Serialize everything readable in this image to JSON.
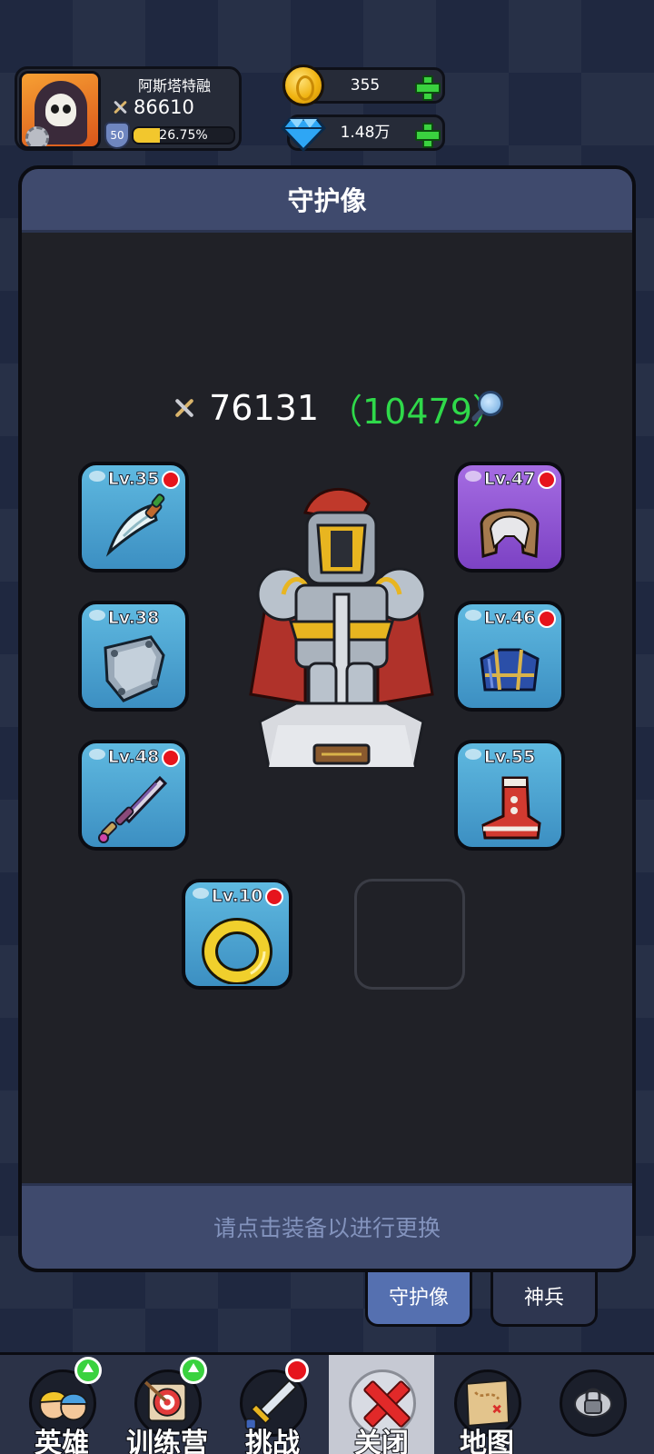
{
  "player": {
    "name": "阿斯塔特融",
    "power": "86610",
    "level": "50",
    "exp_percent_label": "26.75%",
    "exp_fraction": 0.2675
  },
  "currency": {
    "gold": "355",
    "diamonds": "1.48万"
  },
  "panel": {
    "title": "守护像",
    "total_power": "76131",
    "bonus_power": "（10479）",
    "hint": "请点击装备以进行更换"
  },
  "slots": {
    "sword": {
      "level": "Lv.35",
      "item": "curved-sword-icon",
      "alert": true
    },
    "shield": {
      "level": "Lv.38",
      "item": "shield-icon",
      "alert": false
    },
    "dagger": {
      "level": "Lv.48",
      "item": "dagger-icon",
      "alert": true
    },
    "ring": {
      "level": "Lv.10",
      "item": "ring-icon",
      "alert": true
    },
    "helmet": {
      "level": "Lv.47",
      "item": "helmet-icon",
      "alert": true
    },
    "armor": {
      "level": "Lv.46",
      "item": "armor-icon",
      "alert": true
    },
    "boots": {
      "level": "Lv.55",
      "item": "boots-icon",
      "alert": false
    }
  },
  "tabs": {
    "guardian": "守护像",
    "divine": "神兵"
  },
  "nav": {
    "heroes": "英雄",
    "training": "训练营",
    "challenge": "挑战",
    "close": "关闭",
    "map": "地图"
  },
  "colors": {
    "panel_header": "#3f4a6d",
    "bonus_green": "#2fd94a",
    "slot_blue": "#4ea6d4",
    "slot_purple": "#9257d6",
    "alert_red": "#e6141c"
  }
}
